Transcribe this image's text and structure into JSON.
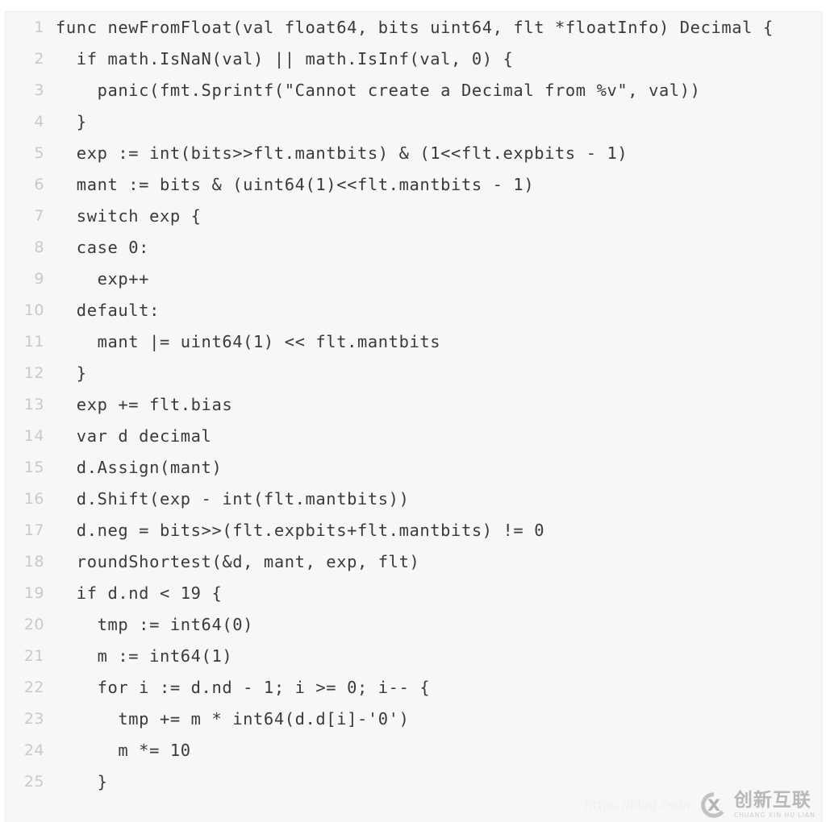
{
  "editor": {
    "language": "go",
    "background_color": "#f7f7f7",
    "text_color": "#3a3a3a",
    "line_number_color": "#c9c9c9",
    "first_line_number": 1,
    "last_line_number": 25,
    "lines": [
      {
        "number": "1",
        "text": "func newFromFloat(val float64, bits uint64, flt *floatInfo) Decimal {"
      },
      {
        "number": "2",
        "text": "  if math.IsNaN(val) || math.IsInf(val, 0) {"
      },
      {
        "number": "3",
        "text": "    panic(fmt.Sprintf(\"Cannot create a Decimal from %v\", val))"
      },
      {
        "number": "4",
        "text": "  }"
      },
      {
        "number": "5",
        "text": "  exp := int(bits>>flt.mantbits) & (1<<flt.expbits - 1)"
      },
      {
        "number": "6",
        "text": "  mant := bits & (uint64(1)<<flt.mantbits - 1)"
      },
      {
        "number": "7",
        "text": "  switch exp {"
      },
      {
        "number": "8",
        "text": "  case 0:"
      },
      {
        "number": "9",
        "text": "    exp++"
      },
      {
        "number": "10",
        "text": "  default:"
      },
      {
        "number": "11",
        "text": "    mant |= uint64(1) << flt.mantbits"
      },
      {
        "number": "12",
        "text": "  }"
      },
      {
        "number": "13",
        "text": "  exp += flt.bias"
      },
      {
        "number": "14",
        "text": "  var d decimal"
      },
      {
        "number": "15",
        "text": "  d.Assign(mant)"
      },
      {
        "number": "16",
        "text": "  d.Shift(exp - int(flt.mantbits))"
      },
      {
        "number": "17",
        "text": "  d.neg = bits>>(flt.expbits+flt.mantbits) != 0"
      },
      {
        "number": "18",
        "text": "  roundShortest(&d, mant, exp, flt)"
      },
      {
        "number": "19",
        "text": "  if d.nd < 19 {"
      },
      {
        "number": "20",
        "text": "    tmp := int64(0)"
      },
      {
        "number": "21",
        "text": "    m := int64(1)"
      },
      {
        "number": "22",
        "text": "    for i := d.nd - 1; i >= 0; i-- {"
      },
      {
        "number": "23",
        "text": "      tmp += m * int64(d.d[i]-'0')"
      },
      {
        "number": "24",
        "text": "      m *= 10"
      },
      {
        "number": "25",
        "text": "    }"
      }
    ]
  },
  "watermark": {
    "url_text": "https://blog.csdn",
    "logo_icon": "circle-x-logo-icon",
    "brand_chinese": "创新互联",
    "brand_pinyin": "CHUANG XIN HU LIAN",
    "color": "#b8b8b8"
  }
}
